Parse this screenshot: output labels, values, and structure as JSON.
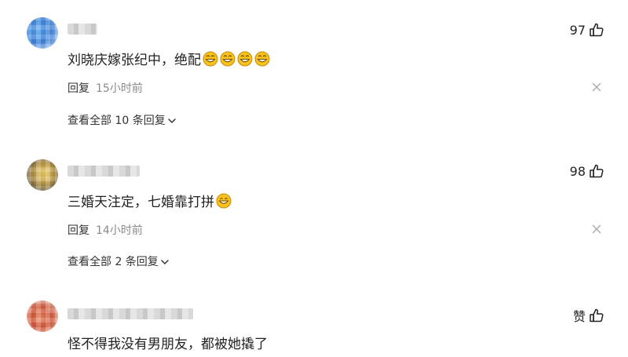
{
  "comments": [
    {
      "text": "刘晓庆嫁张纪中，绝配",
      "emoji_count": 4,
      "likes": "97",
      "reply_label": "回复",
      "time": "15小时前",
      "view_all": "查看全部 10 条回复"
    },
    {
      "text": "三婚天注定，七婚靠打拼",
      "emoji_count": 1,
      "likes": "98",
      "reply_label": "回复",
      "time": "14小时前",
      "view_all": "查看全部 2 条回复"
    },
    {
      "text": "怪不得我没有男朋友，都被她撬了",
      "likes": "赞"
    }
  ],
  "icons": {
    "like": "thumbs-up-icon",
    "close": "close-icon",
    "chevron": "chevron-down-icon",
    "emoji": "grinning-face-emoji"
  },
  "colors": {
    "text": "#222222",
    "muted": "#8a8a8a",
    "emoji": "#f6c21c"
  }
}
